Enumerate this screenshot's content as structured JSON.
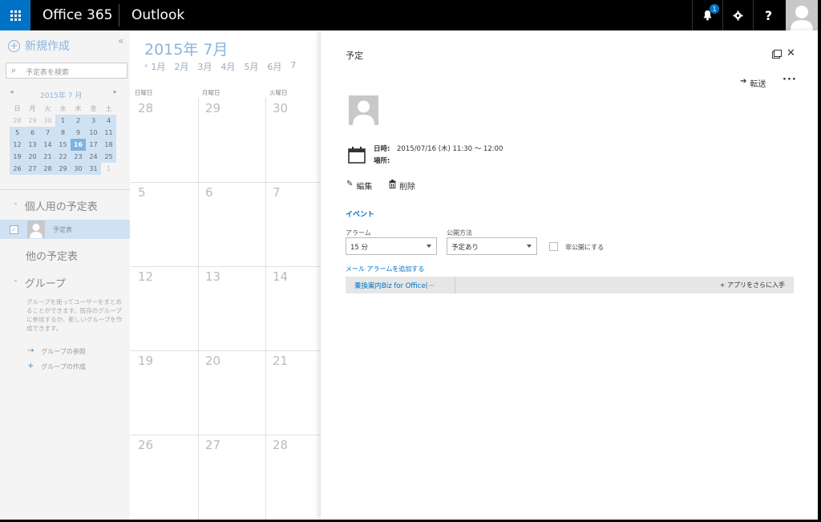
{
  "topbar": {
    "brand": "Office 365",
    "app": "Outlook",
    "notification_count": "1",
    "help_label": "?"
  },
  "left": {
    "new_event": "新規作成",
    "collapse": "«",
    "search_placeholder": "予定表を検索",
    "minical": {
      "title": "2015年 7 月",
      "dow": [
        "日",
        "月",
        "火",
        "水",
        "木",
        "金",
        "土"
      ],
      "weeks": [
        [
          "28",
          "29",
          "30",
          "1",
          "2",
          "3",
          "4"
        ],
        [
          "5",
          "6",
          "7",
          "8",
          "9",
          "10",
          "11"
        ],
        [
          "12",
          "13",
          "14",
          "15",
          "16",
          "17",
          "18"
        ],
        [
          "19",
          "20",
          "21",
          "22",
          "23",
          "24",
          "25"
        ],
        [
          "26",
          "27",
          "28",
          "29",
          "30",
          "31",
          "1"
        ]
      ],
      "today": "16"
    },
    "my_calendars": "個人用の予定表",
    "calendar_item": "予定表",
    "other_calendars": "他の予定表",
    "groups": "グループ",
    "groups_desc": "グループを使ってユーザーをまとめることができます。既存のグループに参加するか、新しいグループを作成できます。",
    "browse_groups": "グループの参照",
    "create_group": "グループの作成"
  },
  "calendar": {
    "month_title": "2015年 7月",
    "prev": "‹",
    "months": [
      "1月",
      "2月",
      "3月",
      "4月",
      "5月",
      "6月",
      "7"
    ],
    "dow": [
      "日曜日",
      "月曜日",
      "火曜日"
    ],
    "weeks": [
      [
        "28",
        "29",
        "30"
      ],
      [
        "5",
        "6",
        "7"
      ],
      [
        "12",
        "13",
        "14"
      ],
      [
        "19",
        "20",
        "21"
      ],
      [
        "26",
        "27",
        "28"
      ]
    ]
  },
  "panel": {
    "title": "予定",
    "forward": "転送",
    "more": "···",
    "date_label": "日時:",
    "date_value": "2015/07/16 (木) 11:30 ～ 12:00",
    "place_label": "場所:",
    "edit": "編集",
    "delete": "削除",
    "events_heading": "イベント",
    "alarm_label": "アラーム",
    "alarm_value": "15 分",
    "publish_label": "公開方法",
    "publish_value": "予定あり",
    "private_label": "非公開にする",
    "add_mail_alarm": "メール アラームを追加する",
    "app_tab": "乗換案内Biz for Office(···",
    "get_more_apps": "アプリをさらに入手"
  },
  "colors": {
    "accent": "#0072c6",
    "topbar": "#000000",
    "today": "#7bb3e0",
    "highlight": "#cfe2f3"
  }
}
